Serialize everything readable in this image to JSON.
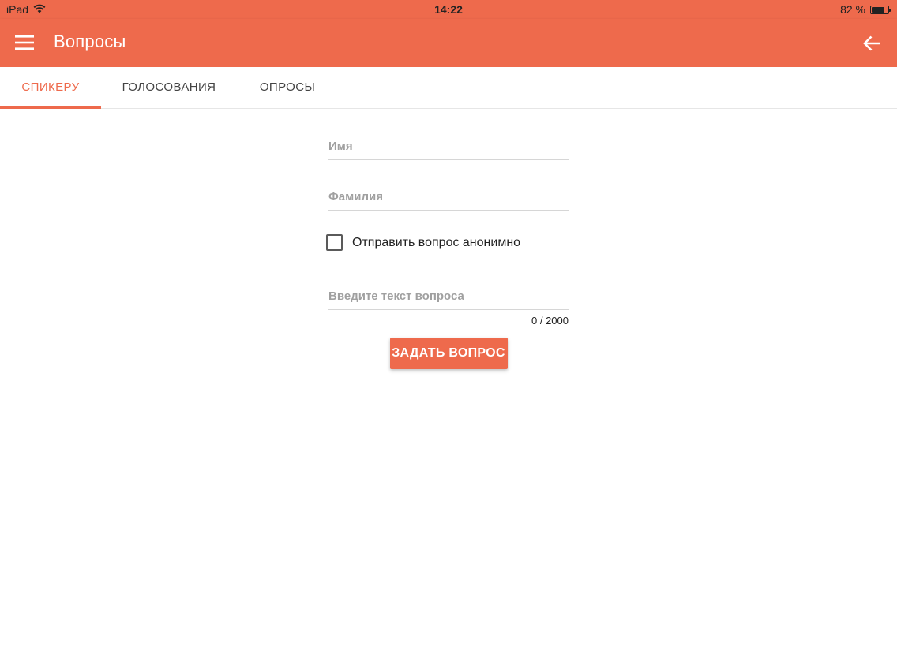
{
  "status_bar": {
    "device": "iPad",
    "wifi_icon": "wifi-icon",
    "time": "14:22",
    "battery_text": "82 %",
    "battery_level": 0.82
  },
  "app_bar": {
    "title": "Вопросы",
    "menu_icon": "hamburger-menu-icon",
    "back_icon": "arrow-left-icon",
    "background_color": "#ee6a4c"
  },
  "tabs": [
    {
      "label": "СПИКЕРУ",
      "active": true
    },
    {
      "label": "ГОЛОСОВАНИЯ",
      "active": false
    },
    {
      "label": "ОПРОСЫ",
      "active": false
    }
  ],
  "form": {
    "first_name": {
      "value": "",
      "placeholder": "Имя"
    },
    "last_name": {
      "value": "",
      "placeholder": "Фамилия"
    },
    "anonymous": {
      "label": "Отправить вопрос анонимно",
      "checked": false
    },
    "question": {
      "value": "",
      "placeholder": "Введите текст вопроса"
    },
    "counter": "0 / 2000",
    "submit_label": "ЗАДАТЬ ВОПРОС"
  },
  "colors": {
    "accent": "#ee6a4c",
    "tab_inactive": "#444444",
    "placeholder": "#a0a0a0"
  }
}
